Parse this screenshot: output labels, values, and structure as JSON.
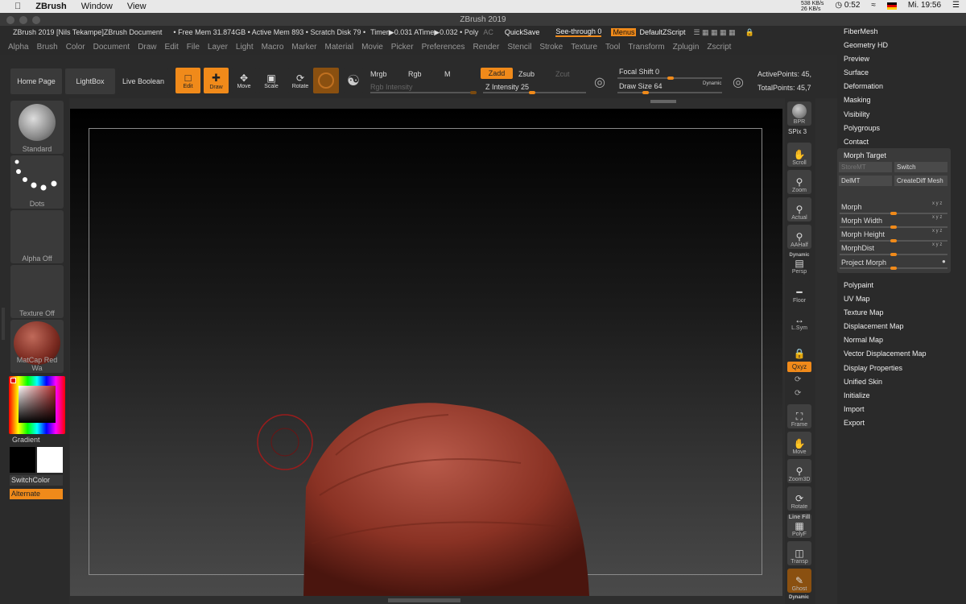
{
  "mac_menu": {
    "app": "ZBrush",
    "items": [
      "Window",
      "View"
    ],
    "net_up": "538 KB/s",
    "net_down": "26 KB/s",
    "time_clock": "0:52",
    "lang_flag": "DE",
    "day_time": "Mi. 19:56"
  },
  "window_title": "ZBrush 2019",
  "info": {
    "doc": "ZBrush 2019 [Nils Tekampe]ZBrush Document",
    "stats": "• Free Mem 31.874GB • Active Mem 893 • Scratch Disk 79 •",
    "timer": "Timer▶0.031 ATime▶0.032 • Poly",
    "ac": "AC",
    "quicksave": "QuickSave",
    "seethrough": "See-through 0",
    "menus": "Menus",
    "zscript": "DefaultZScript"
  },
  "menus": [
    "Alpha",
    "Brush",
    "Color",
    "Document",
    "Draw",
    "Edit",
    "File",
    "Layer",
    "Light",
    "Macro",
    "Marker",
    "Material",
    "Movie",
    "Picker",
    "Preferences",
    "Render",
    "Stencil",
    "Stroke",
    "Texture",
    "Tool",
    "Transform",
    "Zplugin",
    "Zscript"
  ],
  "toolbar": {
    "home": "Home Page",
    "lightbox": "LightBox",
    "liveboolean": "Live Boolean",
    "edit": "Edit",
    "draw": "Draw",
    "move": "Move",
    "scale": "Scale",
    "rotate": "Rotate",
    "mrgb": "Mrgb",
    "rgb": "Rgb",
    "m": "M",
    "rgb_intensity": "Rgb Intensity",
    "zadd": "Zadd",
    "zsub": "Zsub",
    "zcut": "Zcut",
    "z_intensity": "Z Intensity 25",
    "focal_shift": "Focal Shift 0",
    "draw_size": "Draw Size 64",
    "dynamic": "Dynamic",
    "active_points": "ActivePoints: 45,",
    "total_points": "TotalPoints: 45,7"
  },
  "left": {
    "brush": "Standard",
    "stroke": "Dots",
    "alpha": "Alpha Off",
    "texture": "Texture Off",
    "material": "MatCap Red Wa",
    "gradient": "Gradient",
    "switchcolor": "SwitchColor",
    "alternate": "Alternate"
  },
  "right": {
    "bpr": "BPR",
    "spix": "SPix 3",
    "scroll": "Scroll",
    "zoom": "Zoom",
    "actual": "Actual",
    "aahalf": "AAHalf",
    "persp": "Persp",
    "dynamic": "Dynamic",
    "floor": "Floor",
    "lsym": "L.Sym",
    "xyz": "Qxyz",
    "frame": "Frame",
    "move": "Move",
    "zoom3d": "Zoom3D",
    "rotate": "Rotate",
    "linefill": "Line Fill",
    "polyf": "PolyF",
    "transp": "Transp",
    "ghost": "Ghost",
    "dynamic2": "Dynamic"
  },
  "palette": {
    "top": [
      "FiberMesh",
      "Geometry HD",
      "Preview",
      "Surface",
      "Deformation",
      "Masking",
      "Visibility",
      "Polygroups",
      "Contact"
    ],
    "morph_title": "Morph Target",
    "storemt": "StoreMT",
    "switch": "Switch",
    "delmt": "DelMT",
    "creatediff": "CreateDiff Mesh",
    "sliders": [
      "Morph",
      "Morph Width",
      "Morph Height",
      "MorphDist",
      "Project Morph"
    ],
    "bottom": [
      "Polypaint",
      "UV Map",
      "Texture Map",
      "Displacement Map",
      "Normal Map",
      "Vector Displacement Map",
      "Display Properties",
      "Unified Skin",
      "Initialize",
      "Import",
      "Export"
    ]
  }
}
